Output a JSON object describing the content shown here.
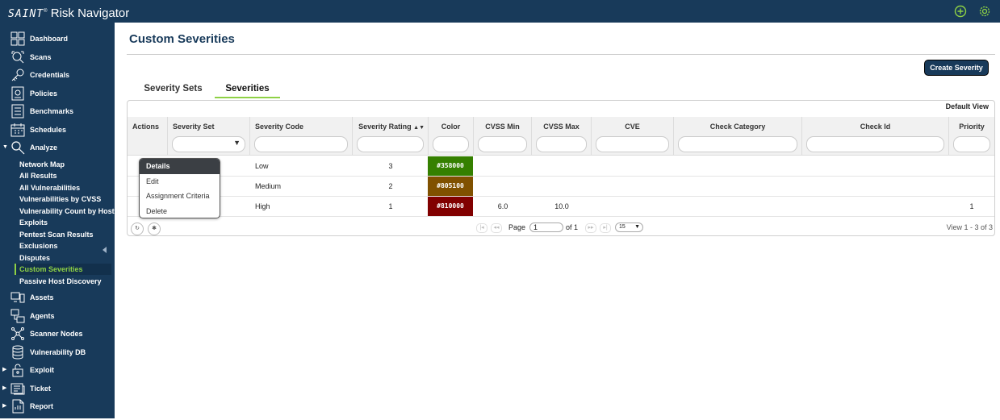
{
  "brand": {
    "logo": "SAINT",
    "mark": "®",
    "product": "Risk Navigator"
  },
  "sidebar": {
    "top_items": [
      {
        "label": "Dashboard",
        "icon": "dashboard-icon"
      },
      {
        "label": "Scans",
        "icon": "scan-icon"
      },
      {
        "label": "Credentials",
        "icon": "key-icon"
      },
      {
        "label": "Policies",
        "icon": "policy-icon"
      },
      {
        "label": "Benchmarks",
        "icon": "benchmark-icon"
      },
      {
        "label": "Schedules",
        "icon": "schedule-icon"
      }
    ],
    "analyze": {
      "label": "Analyze",
      "icon": "search-icon",
      "expanded": true
    },
    "analyze_items": [
      "Network Map",
      "All Results",
      "All Vulnerabilities",
      "Vulnerabilities by CVSS",
      "Vulnerability Count by Host",
      "Exploits",
      "Pentest Scan Results",
      "Exclusions",
      "Disputes",
      "Custom Severities",
      "Passive Host Discovery"
    ],
    "active_item": "Custom Severities",
    "bottom_items": [
      {
        "label": "Assets",
        "icon": "assets-icon"
      },
      {
        "label": "Agents",
        "icon": "agents-icon"
      },
      {
        "label": "Scanner Nodes",
        "icon": "nodes-icon"
      },
      {
        "label": "Vulnerability DB",
        "icon": "database-icon"
      },
      {
        "label": "Exploit",
        "icon": "exploit-icon"
      },
      {
        "label": "Ticket",
        "icon": "ticket-icon"
      },
      {
        "label": "Report",
        "icon": "report-icon"
      }
    ]
  },
  "page": {
    "title": "Custom Severities",
    "create_button": "Create Severity"
  },
  "tabs": [
    "Severity Sets",
    "Severities"
  ],
  "active_tab": "Severities",
  "grid": {
    "view_label": "Default View",
    "columns": [
      "Actions",
      "Severity Set",
      "Severity Code",
      "Severity Rating",
      "Color",
      "CVSS Min",
      "CVSS Max",
      "CVE",
      "Check Category",
      "Check Id",
      "Priority"
    ],
    "sort_icon": "sort-icon",
    "rows": [
      {
        "code": "Low",
        "rating": "3",
        "color": "#358000",
        "cvss_min": "",
        "cvss_max": "",
        "priority": ""
      },
      {
        "code": "Medium",
        "rating": "2",
        "color": "#805100",
        "cvss_min": "",
        "cvss_max": "",
        "priority": ""
      },
      {
        "code": "High",
        "rating": "1",
        "color": "#810000",
        "cvss_min": "6.0",
        "cvss_max": "10.0",
        "priority": "1"
      }
    ]
  },
  "pager": {
    "page_label": "Page",
    "page_value": "1",
    "of_label": "of 1",
    "page_size": "15",
    "summary": "View 1 - 3 of 3"
  },
  "action_menu": {
    "items": [
      "Details",
      "Edit",
      "Assignment Criteria",
      "Delete"
    ],
    "selected": "Details"
  },
  "colors": {
    "nav_bg": "#183a5a",
    "accent_green": "#8ed145"
  }
}
